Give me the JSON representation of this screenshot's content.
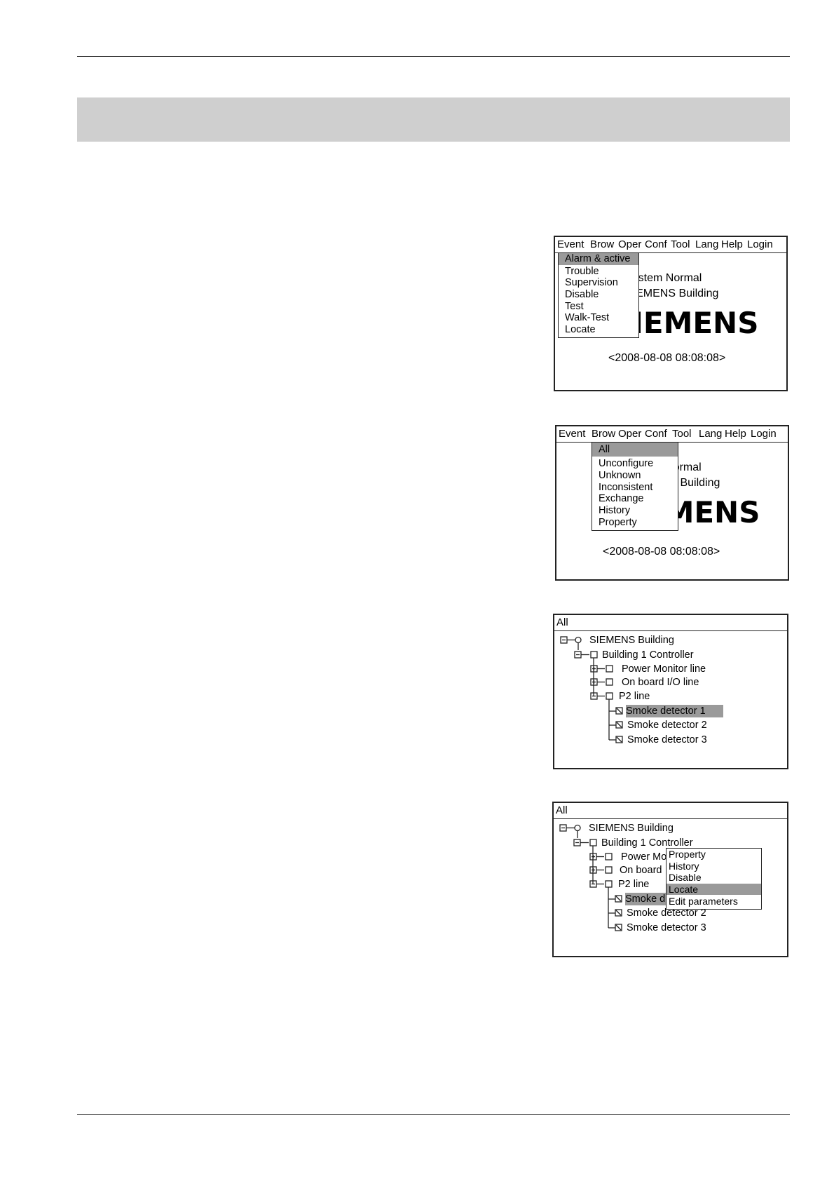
{
  "menubar": {
    "items": [
      "Event",
      "Brow",
      "Oper",
      "Conf",
      "Tool",
      "Lang",
      "Help",
      "Login"
    ]
  },
  "screen1": {
    "status": "System Normal",
    "building": "SIEMENS Building",
    "logo": "SIEMENS",
    "datetime": "<2008-08-08   08:08:08>",
    "dropdown": [
      "Alarm & active",
      "Trouble",
      "Supervision",
      "Disable",
      "Test",
      "Walk-Test",
      "Locate"
    ]
  },
  "screen2": {
    "status": "System normal",
    "building": "SIEMENS Building",
    "logo": "SIEMENS",
    "datetime": "<2008-08-08   08:08:08>",
    "dropdown": [
      "All",
      "Unconfigure",
      "Unknown",
      "Inconsistent",
      "Exchange",
      "History",
      "Property"
    ]
  },
  "tree": {
    "title": "All",
    "nodes": [
      "SIEMENS Building",
      "Building 1 Controller",
      "Power Monitor line",
      "On board I/O line",
      "P2 line",
      "Smoke detector 1",
      "Smoke detector 2",
      "Smoke detector 3"
    ]
  },
  "tree4": {
    "power_partial": "Power Mo",
    "onboard_partial": "On board",
    "smoke1_partial": "Smoke d"
  },
  "context_menu": [
    "Property",
    "History",
    "Disable",
    "Locate",
    "Edit parameters"
  ],
  "colors": {
    "highlight": "#9a9a9a",
    "band": "#cfcfcf"
  }
}
